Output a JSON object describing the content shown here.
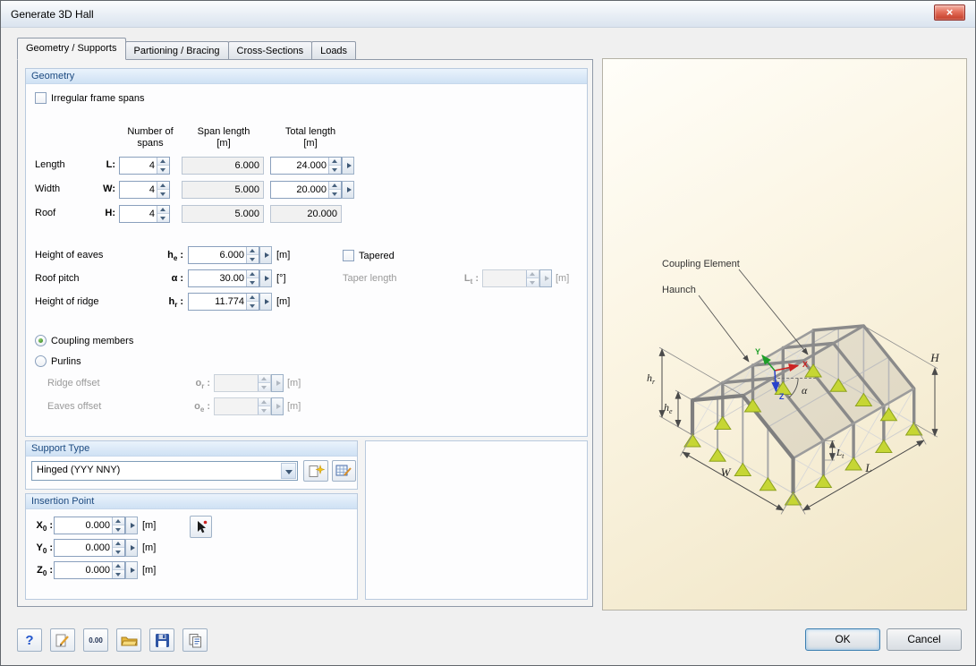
{
  "window": {
    "title": "Generate 3D Hall",
    "close_glyph": "×"
  },
  "punct": {
    "colon": ":"
  },
  "tabs": [
    {
      "label": "Geometry / Supports"
    },
    {
      "label": "Partioning / Bracing"
    },
    {
      "label": "Cross-Sections"
    },
    {
      "label": "Loads"
    }
  ],
  "geometry": {
    "title": "Geometry",
    "irregular_label": "Irregular frame spans",
    "headers": {
      "spans1": "Number of",
      "spans2": "spans",
      "span1": "Span length",
      "span2": "[m]",
      "total1": "Total length",
      "total2": "[m]"
    },
    "rows": [
      {
        "label": "Length",
        "sym": "L:",
        "spans": "4",
        "span_length": "6.000",
        "total": "24.000"
      },
      {
        "label": "Width",
        "sym": "W:",
        "spans": "4",
        "span_length": "5.000",
        "total": "20.000"
      },
      {
        "label": "Roof",
        "sym": "H:",
        "spans": "4",
        "span_length": "5.000",
        "total": "20.000"
      }
    ],
    "eaves": {
      "label": "Height of eaves",
      "sym": "h",
      "sub": "e",
      "value": "6.000",
      "unit": "[m]"
    },
    "tapered_label": "Tapered",
    "pitch": {
      "label": "Roof pitch",
      "sym": "α",
      "sub": "",
      "value": "30.00",
      "unit": "[°]"
    },
    "taper": {
      "label": "Taper length",
      "sym": "L",
      "sub": "t",
      "value": "",
      "unit": "[m]"
    },
    "ridge": {
      "label": "Height of ridge",
      "sym": "h",
      "sub": "r",
      "value": "11.774",
      "unit": "[m]"
    },
    "coupling_label": "Coupling members",
    "purlins_label": "Purlins",
    "ridge_offset": {
      "label": "Ridge offset",
      "sym": "o",
      "sub": "r",
      "value": "",
      "unit": "[m]"
    },
    "eaves_offset": {
      "label": "Eaves offset",
      "sym": "o",
      "sub": "e",
      "value": "",
      "unit": "[m]"
    }
  },
  "support": {
    "title": "Support Type",
    "selected": "Hinged (YYY NNY)"
  },
  "insertion": {
    "title": "Insertion Point",
    "rows": [
      {
        "sym": "X",
        "sub": "0",
        "value": "0.000",
        "unit": "[m]"
      },
      {
        "sym": "Y",
        "sub": "0",
        "value": "0.000",
        "unit": "[m]"
      },
      {
        "sym": "Z",
        "sub": "0",
        "value": "0.000",
        "unit": "[m]"
      }
    ]
  },
  "diagram": {
    "coupling_label": "Coupling Element",
    "haunch_label": "Haunch",
    "dim_H": "H",
    "dim_W": "W",
    "dim_L": "L",
    "hr_main": "h",
    "hr_sub": "r",
    "he_main": "h",
    "he_sub": "e",
    "lt_main": "L",
    "lt_sub": "t",
    "alpha": "α",
    "axis_x": "X",
    "axis_y": "Y",
    "axis_z": "Z"
  },
  "footer": {
    "help_glyph": "?",
    "units_text": "0.00",
    "ok_label": "OK",
    "cancel_label": "Cancel"
  }
}
